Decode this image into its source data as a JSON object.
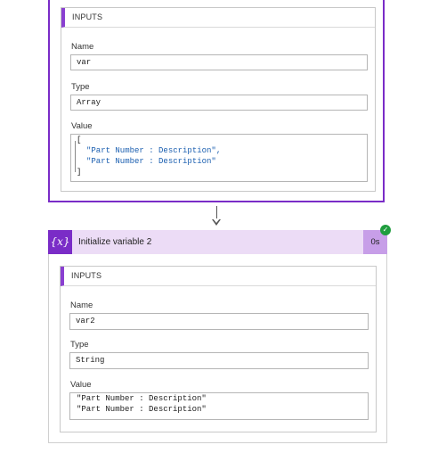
{
  "action1": {
    "inputs_header": "INPUTS",
    "name_label": "Name",
    "name_value": "var",
    "type_label": "Type",
    "type_value": "Array",
    "value_label": "Value",
    "value_lines": [
      "[",
      "\"Part Number : Description\",",
      "\"Part Number : Description\"",
      "]"
    ]
  },
  "action2": {
    "icon": "{x}",
    "icon_name": "variable-icon",
    "title": "Initialize variable 2",
    "duration": "0s",
    "status": "succeeded",
    "inputs_header": "INPUTS",
    "name_label": "Name",
    "name_value": "var2",
    "type_label": "Type",
    "type_value": "String",
    "value_label": "Value",
    "value_lines": [
      "\"Part Number : Description\"",
      "\"Part Number : Description\""
    ]
  },
  "colors": {
    "accent": "#7a2cc7",
    "header_bg": "#ecdcf6",
    "duration_bg": "#c79ee8",
    "success": "#1f9d3e",
    "json_string": "#1b5fb0"
  }
}
